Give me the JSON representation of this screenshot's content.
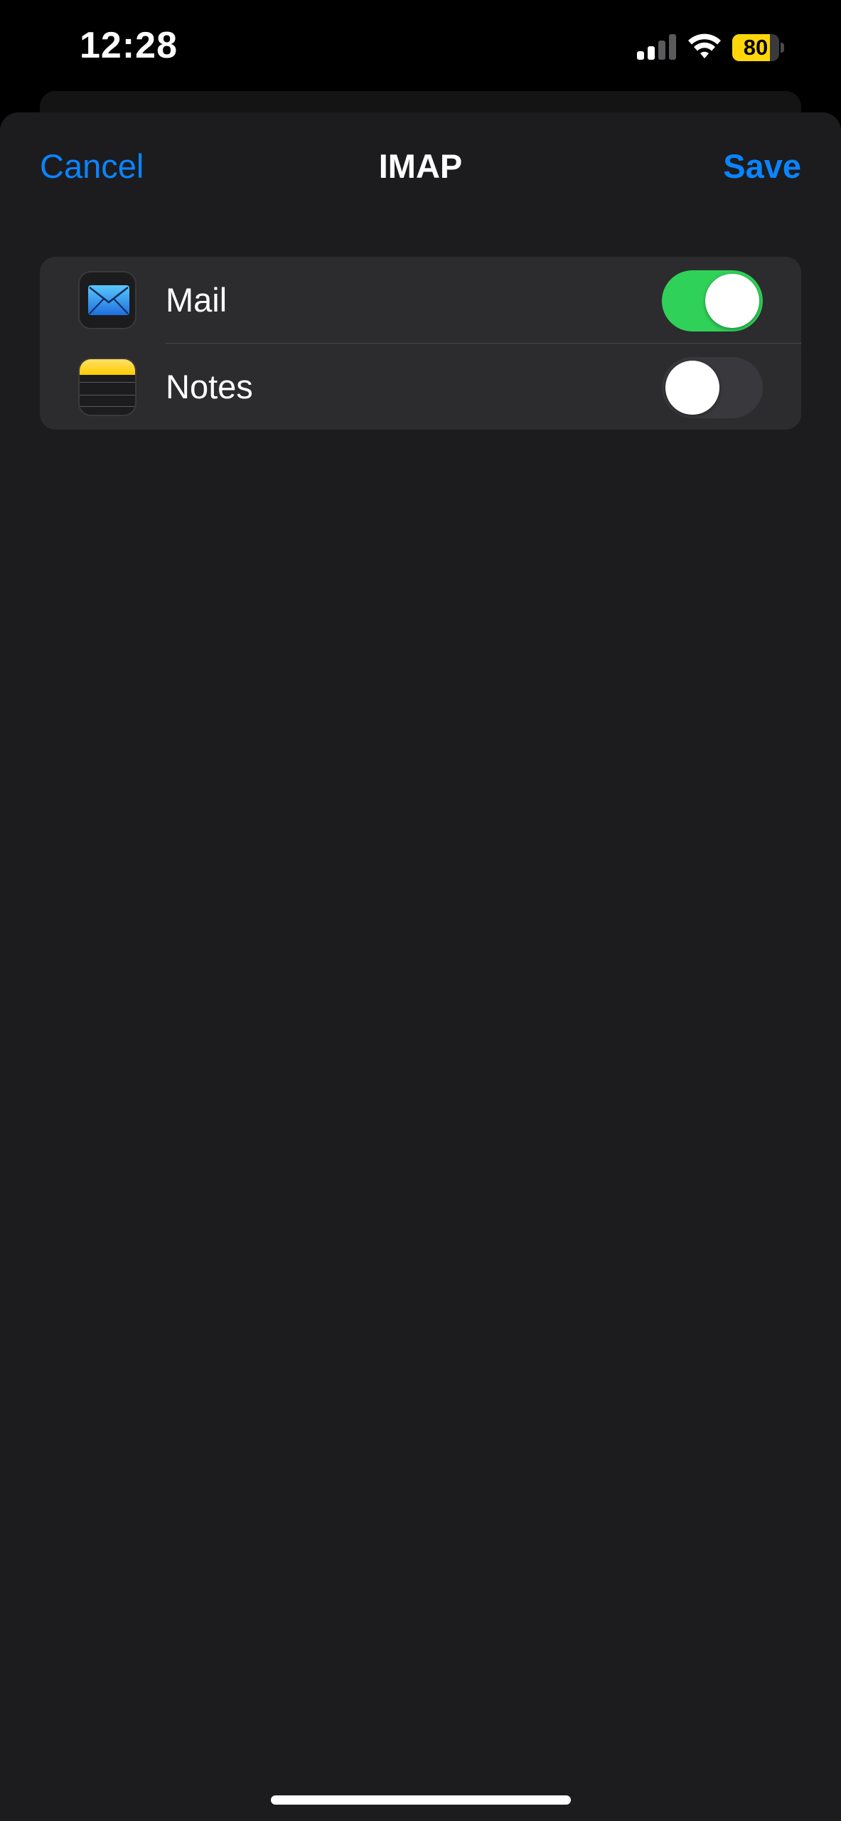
{
  "status_bar": {
    "time": "12:28",
    "battery_level": "80",
    "battery_color": "#ffd60a",
    "signal_icon": "cellular-signal-icon",
    "wifi_icon": "wifi-icon"
  },
  "nav": {
    "cancel_label": "Cancel",
    "title": "IMAP",
    "save_label": "Save",
    "accent_color": "#0a84ff"
  },
  "settings": {
    "rows": [
      {
        "label": "Mail",
        "icon": "mail-app-icon",
        "enabled": true
      },
      {
        "label": "Notes",
        "icon": "notes-app-icon",
        "enabled": false
      }
    ],
    "toggle_on_color": "#30d158",
    "toggle_off_color": "#39393d"
  }
}
